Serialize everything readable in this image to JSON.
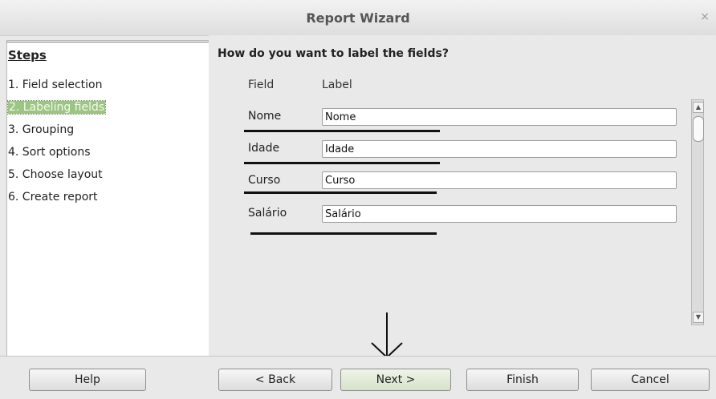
{
  "window": {
    "title": "Report Wizard",
    "close_glyph": "×"
  },
  "sidebar": {
    "title": "Steps",
    "items": [
      {
        "label": "1. Field selection",
        "active": false
      },
      {
        "label": "2. Labeling fields",
        "active": true
      },
      {
        "label": "3. Grouping",
        "active": false
      },
      {
        "label": "4. Sort options",
        "active": false
      },
      {
        "label": "5. Choose layout",
        "active": false
      },
      {
        "label": "6. Create report",
        "active": false
      }
    ]
  },
  "main": {
    "question": "How do you want to label the fields?",
    "columns": {
      "field": "Field",
      "label": "Label"
    },
    "rows": [
      {
        "field": "Nome",
        "label": "Nome"
      },
      {
        "field": "Idade",
        "label": "Idade"
      },
      {
        "field": "Curso",
        "label": "Curso"
      },
      {
        "field": "Salário",
        "label": "Salário"
      }
    ]
  },
  "buttons": {
    "help": "Help",
    "back": "< Back",
    "next": "Next >",
    "finish": "Finish",
    "cancel": "Cancel"
  },
  "colors": {
    "active_step_bg": "#9cc584",
    "annotation": "#111111"
  }
}
